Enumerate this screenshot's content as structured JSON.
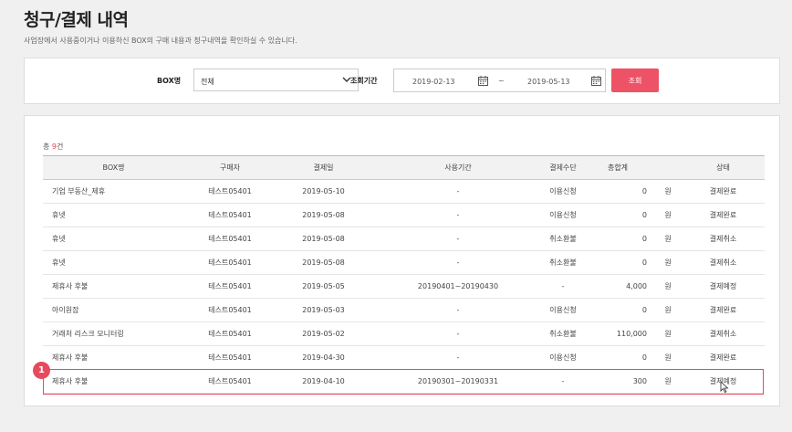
{
  "header": {
    "title": "청구/결제 내역",
    "description": "사업장에서 사용중이거나 이용하신 BOX의 구매 내용과 청구내역을 확인하실 수 있습니다."
  },
  "filter": {
    "box_label": "BOX명",
    "box_select_value": "전체",
    "period_label": "조회기간",
    "date_from": "2019-02-13",
    "date_separator": "~",
    "date_to": "2019-05-13",
    "search_label": "조회"
  },
  "list": {
    "total_prefix": "총 ",
    "total_count": "9",
    "total_suffix": "건",
    "columns": [
      "BOX명",
      "구매자",
      "결제일",
      "사용기간",
      "결제수단",
      "총합계",
      "",
      "상태"
    ],
    "rows": [
      {
        "name": "기업 부동산_제휴",
        "buyer": "테스트05401",
        "date": "2019-05-10",
        "period": "-",
        "method": "이용신청",
        "total": "0",
        "unit": "원",
        "status": "결제완료"
      },
      {
        "name": "휴넷",
        "buyer": "테스트05401",
        "date": "2019-05-08",
        "period": "-",
        "method": "이용신청",
        "total": "0",
        "unit": "원",
        "status": "결제완료"
      },
      {
        "name": "휴넷",
        "buyer": "테스트05401",
        "date": "2019-05-08",
        "period": "-",
        "method": "취소환불",
        "total": "0",
        "unit": "원",
        "status": "결제취소"
      },
      {
        "name": "휴넷",
        "buyer": "테스트05401",
        "date": "2019-05-08",
        "period": "-",
        "method": "취소환불",
        "total": "0",
        "unit": "원",
        "status": "결제취소"
      },
      {
        "name": "제휴사 후불",
        "buyer": "테스트05401",
        "date": "2019-05-05",
        "period": "20190401~20190430",
        "method": "-",
        "total": "4,000",
        "unit": "원",
        "status": "결제예정"
      },
      {
        "name": "아이원잡",
        "buyer": "테스트05401",
        "date": "2019-05-03",
        "period": "-",
        "method": "이용신청",
        "total": "0",
        "unit": "원",
        "status": "결제완료"
      },
      {
        "name": "거래처 리스크 모니터링",
        "buyer": "테스트05401",
        "date": "2019-05-02",
        "period": "-",
        "method": "취소환불",
        "total": "110,000",
        "unit": "원",
        "status": "결제취소"
      },
      {
        "name": "제휴사 후불",
        "buyer": "테스트05401",
        "date": "2019-04-30",
        "period": "-",
        "method": "이용신청",
        "total": "0",
        "unit": "원",
        "status": "결제완료"
      },
      {
        "name": "제휴사 후불",
        "buyer": "테스트05401",
        "date": "2019-04-10",
        "period": "20190301~20190331",
        "method": "-",
        "total": "300",
        "unit": "원",
        "status": "결제예정"
      }
    ]
  },
  "annotation": {
    "badge_number": "1",
    "accent": "#e64a5c"
  }
}
